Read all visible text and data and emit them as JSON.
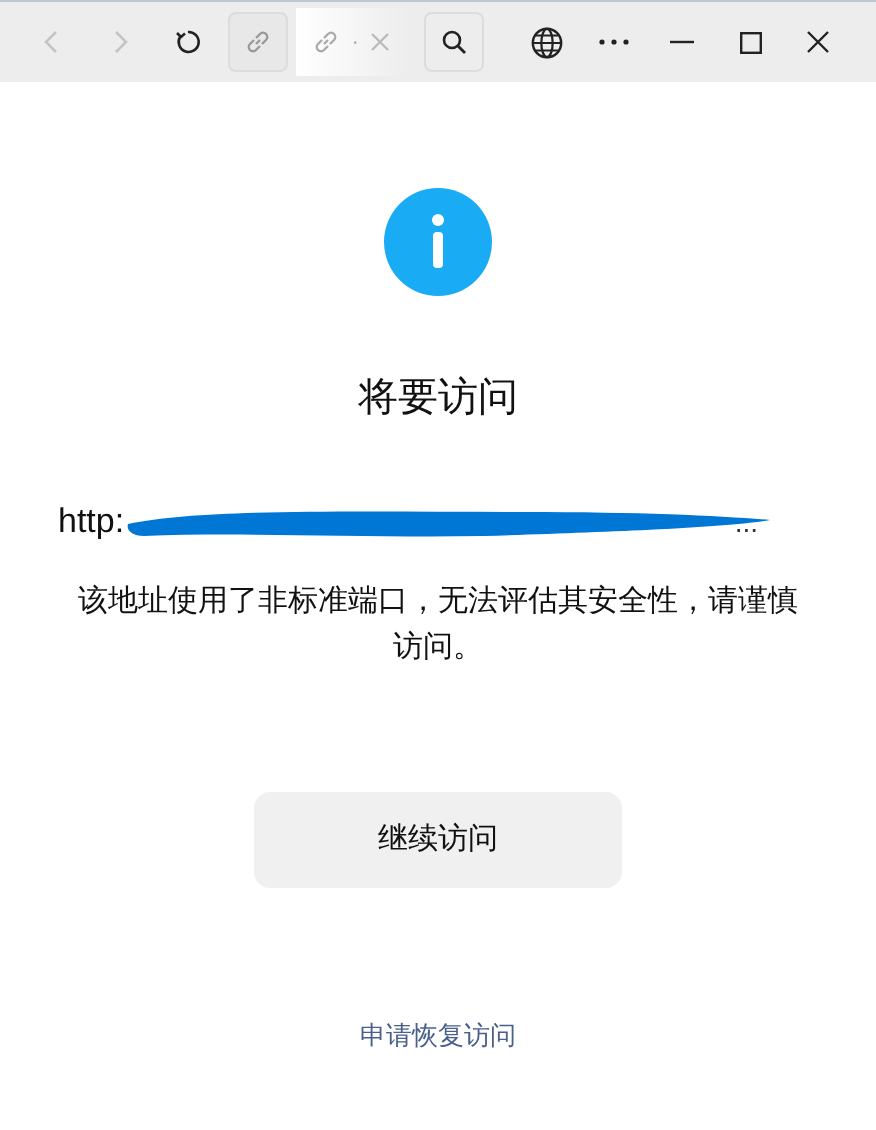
{
  "toolbar": {
    "back": {
      "disabled": true
    },
    "forward": {
      "disabled": true
    },
    "tab": {
      "dot": "·"
    }
  },
  "dialog": {
    "title": "将要访问",
    "url": {
      "prefix": "http:",
      "suffix": "..."
    },
    "message": "该地址使用了非标准端口，无法评估其安全性，请谨慎访问。",
    "continue_button": "继续访问",
    "appeal_link": "申请恢复访问"
  }
}
